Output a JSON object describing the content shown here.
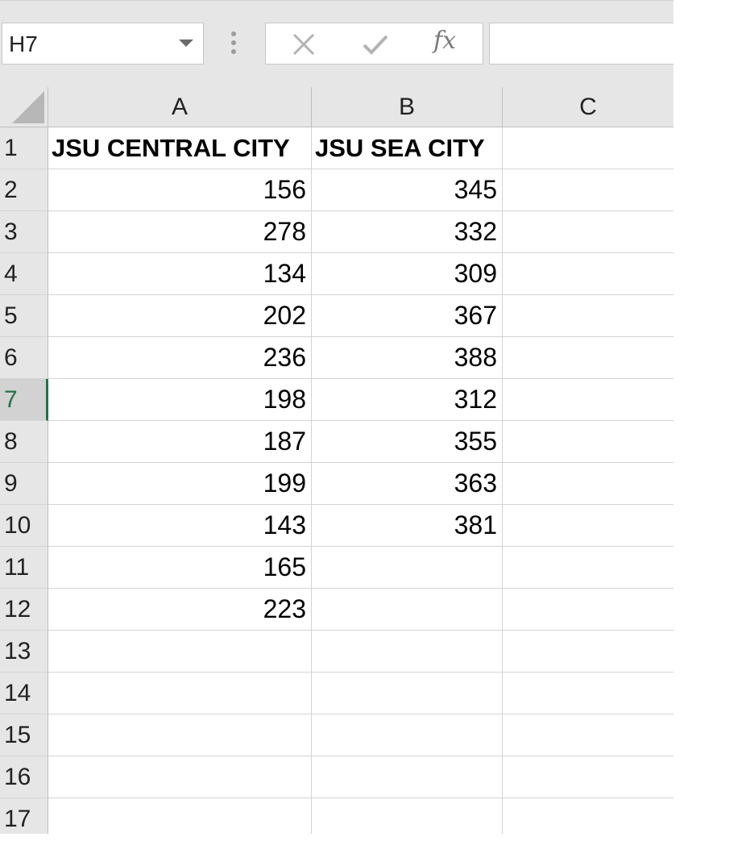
{
  "formula_bar": {
    "name_box": "H7",
    "fx_label": "fx",
    "formula_value": ""
  },
  "columns": [
    "A",
    "B",
    "C"
  ],
  "active_row": "7",
  "rows": [
    {
      "num": "1",
      "a": "JSU CENTRAL CITY",
      "b": "JSU SEA CITY",
      "c": ""
    },
    {
      "num": "2",
      "a": "156",
      "b": "345",
      "c": ""
    },
    {
      "num": "3",
      "a": "278",
      "b": "332",
      "c": ""
    },
    {
      "num": "4",
      "a": "134",
      "b": "309",
      "c": ""
    },
    {
      "num": "5",
      "a": "202",
      "b": "367",
      "c": ""
    },
    {
      "num": "6",
      "a": "236",
      "b": "388",
      "c": ""
    },
    {
      "num": "7",
      "a": "198",
      "b": "312",
      "c": ""
    },
    {
      "num": "8",
      "a": "187",
      "b": "355",
      "c": ""
    },
    {
      "num": "9",
      "a": "199",
      "b": "363",
      "c": ""
    },
    {
      "num": "10",
      "a": "143",
      "b": "381",
      "c": ""
    },
    {
      "num": "11",
      "a": "165",
      "b": "",
      "c": ""
    },
    {
      "num": "12",
      "a": "223",
      "b": "",
      "c": ""
    },
    {
      "num": "13",
      "a": "",
      "b": "",
      "c": ""
    },
    {
      "num": "14",
      "a": "",
      "b": "",
      "c": ""
    },
    {
      "num": "15",
      "a": "",
      "b": "",
      "c": ""
    },
    {
      "num": "16",
      "a": "",
      "b": "",
      "c": ""
    },
    {
      "num": "17",
      "a": "",
      "b": "",
      "c": ""
    }
  ],
  "colors": {
    "active_row_accent": "#217346",
    "header_bg": "#e6e6e6"
  }
}
